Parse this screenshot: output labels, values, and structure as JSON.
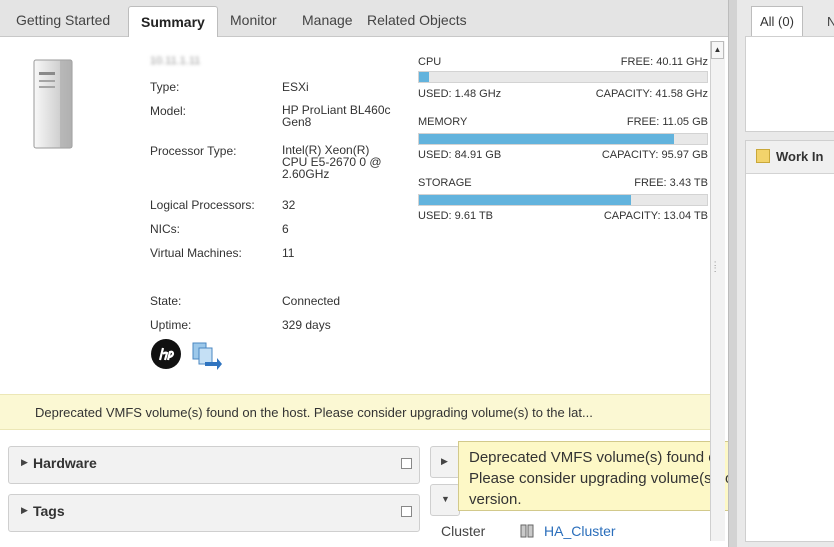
{
  "tabs": [
    {
      "label": "Getting Started"
    },
    {
      "label": "Summary"
    },
    {
      "label": "Monitor"
    },
    {
      "label": "Manage"
    },
    {
      "label": "Related Objects"
    }
  ],
  "host": {
    "name": "10.11.1.11",
    "fields": [
      {
        "label": "Type:",
        "value": "ESXi"
      },
      {
        "label": "Model:",
        "value": "HP ProLiant BL460c Gen8"
      },
      {
        "label": "Processor Type:",
        "value": "Intel(R) Xeon(R) CPU E5-2670 0 @ 2.60GHz"
      },
      {
        "label": "Logical Processors:",
        "value": "32"
      },
      {
        "label": "NICs:",
        "value": "6"
      },
      {
        "label": "Virtual Machines:",
        "value": "11"
      },
      {
        "label": "State:",
        "value": "Connected"
      },
      {
        "label": "Uptime:",
        "value": "329 days"
      }
    ]
  },
  "resources": [
    {
      "name": "CPU",
      "free": "FREE: 40.11 GHz",
      "used": "USED: 1.48 GHz",
      "capacity": "CAPACITY: 41.58 GHz",
      "fill": 0.036
    },
    {
      "name": "MEMORY",
      "free": "FREE: 11.05 GB",
      "used": "USED: 84.91 GB",
      "capacity": "CAPACITY: 95.97 GB",
      "fill": 0.885
    },
    {
      "name": "STORAGE",
      "free": "FREE: 3.43 TB",
      "used": "USED: 9.61 TB",
      "capacity": "CAPACITY: 13.04 TB",
      "fill": 0.737
    }
  ],
  "warning": "Deprecated VMFS volume(s) found on the host. Please consider upgrading volume(s) to the lat...",
  "tooltip": "Deprecated VMFS volume(s) found on the host. Please consider upgrading volume(s) to the latest version.",
  "panels": {
    "hardware": "Hardware",
    "tags": "Tags"
  },
  "cluster": {
    "label": "Cluster",
    "value": "HA_Cluster"
  },
  "right": {
    "tab_all": "All (0)",
    "tab_next": "N",
    "work_title": "Work In"
  },
  "colors": {
    "bar_fill": "#62b3dd",
    "warning_bg": "#fbf8d3",
    "link": "#2a6ebb"
  }
}
